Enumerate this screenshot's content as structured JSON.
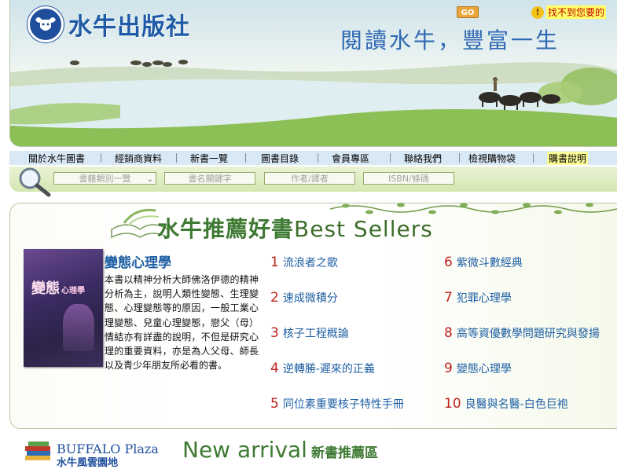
{
  "header": {
    "publisher_name": "水牛出版社",
    "slogan": "閱讀水牛，豐富一生"
  },
  "nav": {
    "items": [
      {
        "label": "關於水牛圖書"
      },
      {
        "label": "經銷商資料"
      },
      {
        "label": "新書一覽"
      },
      {
        "label": "圖書目錄"
      },
      {
        "label": "會員專區"
      },
      {
        "label": "聯絡我們"
      },
      {
        "label": "檢視購物袋"
      },
      {
        "label": "購書說明"
      }
    ]
  },
  "search": {
    "category_select": "書籍類別一覽",
    "title_placeholder": "書名關鍵字",
    "author_placeholder": "作者/譯者",
    "isbn_placeholder": "ISBN/條碼",
    "go_label": "GO",
    "not_found_label": "找不到您要的"
  },
  "best_sellers": {
    "heading_cn": "水牛推薦好書",
    "heading_en": "Best Sellers",
    "featured": {
      "title": "變態心理學",
      "cover_title": "變態",
      "cover_subtitle": "心理學",
      "description": "本書以精神分析大師佛洛伊德的精神分析為主，說明人類性變態、生理變態、心理變態等的原因，一般工業心理變態、兒童心理變態，戀父（母）情結亦有詳盡的說明，不但是研究心理的重要資料，亦是為人父母、師長以及青少年朋友所必看的書。"
    },
    "ranking": [
      {
        "rank": "1",
        "title": "流浪者之歌"
      },
      {
        "rank": "2",
        "title": "速成微積分"
      },
      {
        "rank": "3",
        "title": "核子工程概論"
      },
      {
        "rank": "4",
        "title": "逆轉勝-遲來的正義"
      },
      {
        "rank": "5",
        "title": "同位素重要核子特性手冊"
      },
      {
        "rank": "6",
        "title": "紫微斗數經典"
      },
      {
        "rank": "7",
        "title": "犯罪心理學"
      },
      {
        "rank": "8",
        "title": "高等資優數學問題研究與發揚"
      },
      {
        "rank": "9",
        "title": "變態心理學"
      },
      {
        "rank": "10",
        "title": "良醫與名醫-白色巨袍"
      }
    ]
  },
  "new_arrival": {
    "plaza_label": "BUFFALO Plaza",
    "plaza_sub": "水牛風雲園地",
    "heading_en": "New arrival",
    "heading_cn": "新書推薦區"
  },
  "colors": {
    "brand_blue": "#1f5aa6",
    "rank_red": "#c0211d",
    "link_blue": "#1e5fa3",
    "accent_green": "#3e7a33"
  }
}
